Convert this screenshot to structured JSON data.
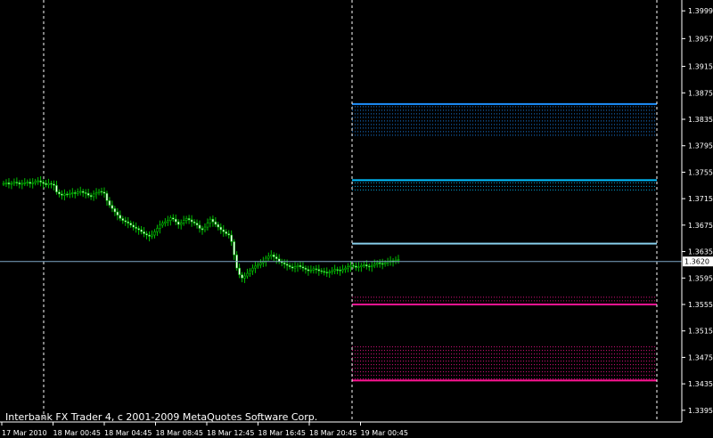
{
  "chart_data": {
    "type": "candlestick",
    "title": "",
    "copyright": "Interbank FX Trader 4, c 2001-2009 MetaQuotes Software Corp.",
    "ylim": [
      1.338,
      1.401
    ],
    "y_ticks": [
      "1.3999",
      "1.3957",
      "1.3915",
      "1.3875",
      "1.3835",
      "1.3795",
      "1.3755",
      "1.3715",
      "1.3675",
      "1.3635",
      "1.3595",
      "1.3555",
      "1.3515",
      "1.3475",
      "1.3435",
      "1.3395"
    ],
    "x_ticks": [
      "17 Mar 2010",
      "18 Mar 00:45",
      "18 Mar 04:45",
      "18 Mar 08:45",
      "18 Mar 12:45",
      "18 Mar 16:45",
      "18 Mar 20:45",
      "19 Mar 00:45"
    ],
    "current_price": "1.3620",
    "grid": false,
    "colors": {
      "background": "#000000",
      "candles": "#00c000",
      "axis": "#ffffff",
      "price_line": "#7fa8c8",
      "separator": "#ffffff",
      "blue_levels": "#1e90ff",
      "cyan_levels": "#00bfff",
      "light_level": "#87ceeb",
      "pink_levels": "#ff1493"
    },
    "price_series": [
      1.3738,
      1.3739,
      1.3737,
      1.3738,
      1.374,
      1.3739,
      1.3737,
      1.3738,
      1.3739,
      1.374,
      1.3738,
      1.3739,
      1.3741,
      1.3742,
      1.374,
      1.3738,
      1.3736,
      1.3738,
      1.3737,
      1.3735,
      1.3725,
      1.3722,
      1.372,
      1.3722,
      1.3721,
      1.3723,
      1.3724,
      1.3723,
      1.3725,
      1.3726,
      1.3724,
      1.3723,
      1.372,
      1.3718,
      1.3722,
      1.3724,
      1.3726,
      1.3725,
      1.3723,
      1.3712,
      1.3705,
      1.37,
      1.3695,
      1.369,
      1.3685,
      1.3682,
      1.368,
      1.3678,
      1.3675,
      1.3672,
      1.367,
      1.3668,
      1.3665,
      1.3662,
      1.366,
      1.3658,
      1.366,
      1.3665,
      1.367,
      1.3675,
      1.3678,
      1.368,
      1.3682,
      1.3686,
      1.3684,
      1.368,
      1.3676,
      1.3678,
      1.3682,
      1.3685,
      1.3683,
      1.368,
      1.3678,
      1.3675,
      1.367,
      1.3668,
      1.3672,
      1.3678,
      1.3684,
      1.368,
      1.3676,
      1.3672,
      1.3668,
      1.3665,
      1.3662,
      1.366,
      1.365,
      1.363,
      1.361,
      1.36,
      1.3595,
      1.3598,
      1.3602,
      1.3606,
      1.361,
      1.3613,
      1.3615,
      1.3618,
      1.362,
      1.3625,
      1.3628,
      1.363,
      1.3627,
      1.3624,
      1.362,
      1.3618,
      1.3616,
      1.3614,
      1.3612,
      1.361,
      1.3612,
      1.3614,
      1.3612,
      1.361,
      1.3608,
      1.3606,
      1.3607,
      1.3609,
      1.3608,
      1.3606,
      1.3605,
      1.3604,
      1.3603,
      1.3604,
      1.3606,
      1.3608,
      1.3607,
      1.3606,
      1.3608,
      1.361,
      1.3612,
      1.3614,
      1.3613,
      1.3611,
      1.3612,
      1.3614,
      1.3615,
      1.3613,
      1.3612,
      1.3614,
      1.3616,
      1.3618,
      1.3617,
      1.3616,
      1.3618,
      1.362,
      1.3621,
      1.362,
      1.3622,
      1.3623
    ],
    "vertical_separators": [
      "17 Mar 23:00",
      "19 Mar 00:00",
      "19 Mar 12:00"
    ],
    "level_bands": [
      {
        "color": "blue_levels",
        "top": 1.3858,
        "bottom": 1.3808,
        "solid": 1.3858
      },
      {
        "color": "cyan_levels",
        "top": 1.3743,
        "bottom": 1.3725,
        "solid": 1.3743
      },
      {
        "color": "light_level",
        "top": 1.3647,
        "bottom": 1.3647,
        "solid": 1.3647
      },
      {
        "color": "pink_levels",
        "top": 1.357,
        "bottom": 1.355,
        "solid": 1.3555
      },
      {
        "color": "pink_levels",
        "top": 1.3495,
        "bottom": 1.344,
        "solid": 1.344
      }
    ]
  }
}
